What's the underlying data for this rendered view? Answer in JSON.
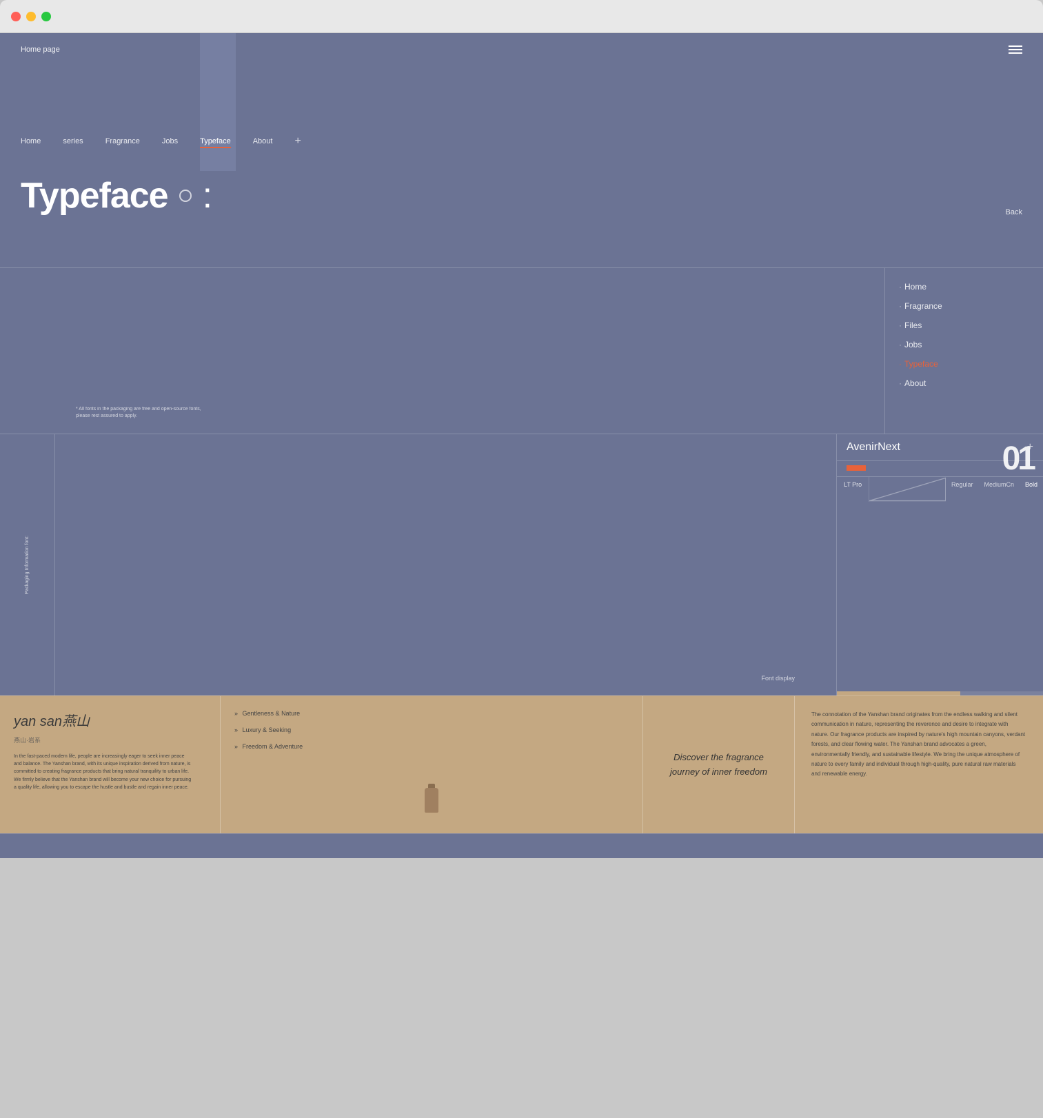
{
  "browser": {
    "traffic_lights": [
      "red",
      "yellow",
      "green"
    ]
  },
  "topBar": {
    "homepage_label": "Home page",
    "menu_icon": "hamburger"
  },
  "nav": {
    "items": [
      {
        "label": "Home",
        "active": false
      },
      {
        "label": "series",
        "active": false
      },
      {
        "label": "Fragrance",
        "active": false
      },
      {
        "label": "Jobs",
        "active": false
      },
      {
        "label": "Typeface",
        "active": true
      },
      {
        "label": "About",
        "active": false
      },
      {
        "label": "+",
        "active": false
      }
    ]
  },
  "pageTitle": {
    "text": "Typeface",
    "colon": ":",
    "back_label": "Back"
  },
  "rightMenu": {
    "items": [
      {
        "label": "Home",
        "active": false
      },
      {
        "label": "Fragrance",
        "active": false
      },
      {
        "label": "Files",
        "active": false
      },
      {
        "label": "Jobs",
        "active": false
      },
      {
        "label": "Typeface",
        "active": true
      },
      {
        "label": "About",
        "active": false
      }
    ]
  },
  "footnote": {
    "line1": "* All fonts in the packaging are free and open-source fonts,",
    "line2": "please rest assured to apply."
  },
  "fontPanel": {
    "font_name": "AvenirNext",
    "plus_label": "+",
    "font_number": "01",
    "sub_font": "LT Pro",
    "weights": [
      "Regular",
      "MediumCn",
      "Bold"
    ],
    "font_display_label": "Font\ndisplay"
  },
  "packagingLabel": {
    "text": "Packaging\nInformation\nfont:"
  },
  "bottomSection": {
    "brand_title": "yan san燕山",
    "brand_subtitle": "燕山·岩系",
    "body_text": "In the fast-paced modern life, people are increasingly eager to seek inner peace and balance. The Yanshan brand, with its unique inspiration derived from nature, is committed to creating fragrance products that bring natural tranquility to urban life. We firmly believe that the Yanshan brand will become your new choice for pursuing a quality life, allowing you to escape the hustle and bustle and regain inner peace.",
    "menu_items": [
      {
        "bullet": "»",
        "label": "Gentleness & Nature"
      },
      {
        "bullet": "»",
        "label": "Luxury & Seeking"
      },
      {
        "bullet": "»",
        "label": "Freedom & Adventure"
      }
    ],
    "discover_line1": "Discover the fragrance",
    "discover_line2": "journey of inner freedom",
    "brand_description": "The connotation of the Yanshan brand originates from the endless walking and silent communication in nature, representing the reverence and desire to integrate with nature. Our fragrance products are inspired by nature's high mountain canyons, verdant forests, and clear flowing water. The Yanshan brand advocates a green, environmentally friendly, and sustainable lifestyle. We bring the unique atmosphere of nature to every family and individual through high-quality, pure natural raw materials and renewable energy."
  }
}
